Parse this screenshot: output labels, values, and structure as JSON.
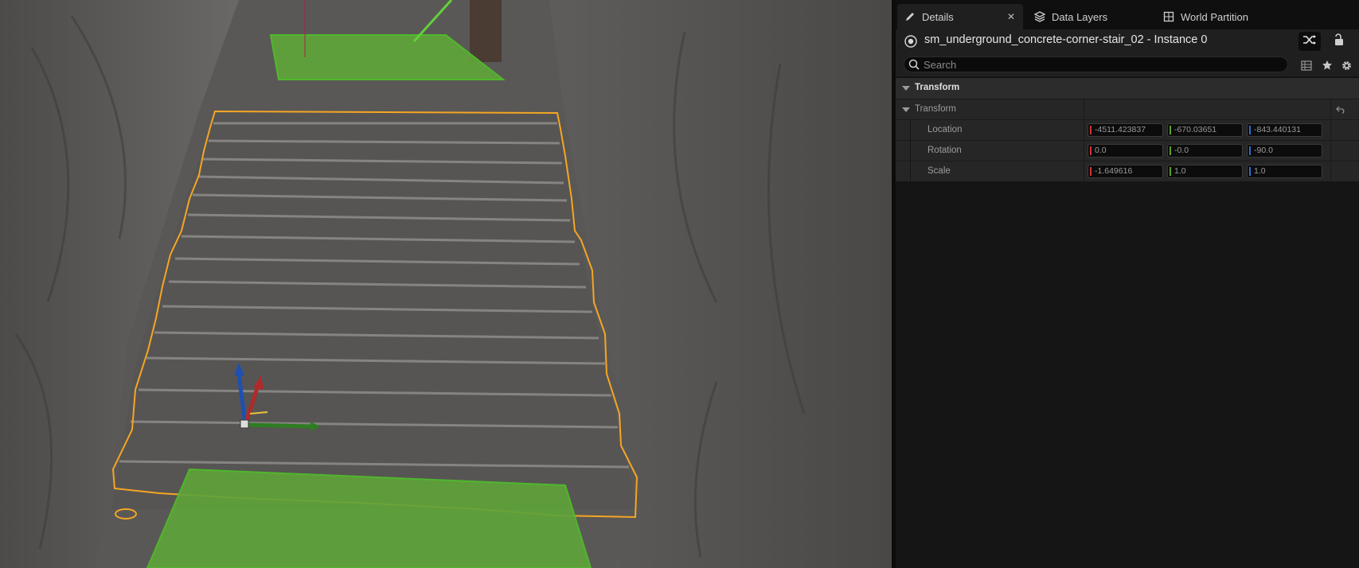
{
  "tabs": [
    {
      "label": "Details",
      "icon": "pencil-icon",
      "active": true
    },
    {
      "label": "Data Layers",
      "icon": "layers-icon",
      "active": false
    },
    {
      "label": "World Partition",
      "icon": "grid-icon",
      "active": false
    }
  ],
  "actor": {
    "name": "sm_underground_concrete-corner-stair_02 - Instance 0",
    "icon": "actor-icon"
  },
  "search": {
    "placeholder": "Search",
    "value": ""
  },
  "section": {
    "title": "Transform",
    "subsection": "Transform",
    "rows": [
      {
        "label": "Location",
        "x": "-4511.423837",
        "y": "-670.03651",
        "z": "-843.440131"
      },
      {
        "label": "Rotation",
        "x": "0.0",
        "y": "-0.0",
        "z": "-90.0"
      },
      {
        "label": "Scale",
        "x": "-1.649616",
        "y": "1.0",
        "z": "1.0"
      }
    ]
  },
  "colors": {
    "selection_outline": "#f5a623",
    "volume_green": "#5fa33a",
    "axis_x": "#d23434",
    "axis_y": "#5aa02a",
    "axis_z": "#2d6fd0"
  }
}
